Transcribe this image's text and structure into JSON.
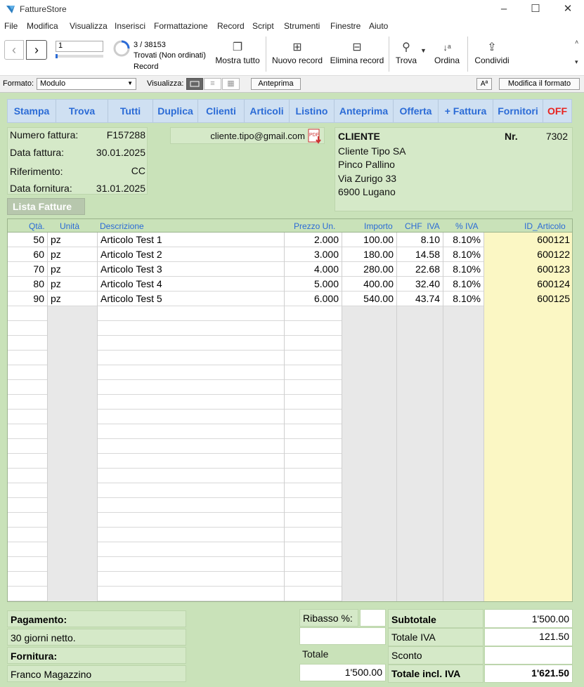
{
  "window": {
    "title": "FattureStore"
  },
  "menu": [
    "File",
    "Modifica",
    "Visualizza",
    "Inserisci",
    "Formattazione",
    "Record",
    "Script",
    "Strumenti",
    "Finestre",
    "Aiuto"
  ],
  "toolbar": {
    "record_field": "1",
    "record_count": "3 / 38153",
    "found_status": "Trovati (Non ordinati)",
    "record_label": "Record",
    "show_all": "Mostra tutto",
    "new_record": "Nuovo record",
    "delete_record": "Elimina record",
    "find": "Trova",
    "sort": "Ordina",
    "share": "Condividi"
  },
  "formatbar": {
    "format_label": "Formato:",
    "format_value": "Modulo",
    "view_label": "Visualizza:",
    "preview": "Anteprima",
    "aa": "Aª",
    "edit_layout": "Modifica il formato"
  },
  "nav": [
    "Stampa",
    "Trova",
    "Tutti",
    "Duplica",
    "Clienti",
    "Articoli",
    "Listino",
    "Anteprima",
    "Offerta",
    "+ Fattura",
    "Fornitori",
    "OFF"
  ],
  "colors": {
    "nav_text": "#2b6bd6",
    "off": "#e8231f",
    "bg": "#c9e2b9"
  },
  "invoice": {
    "number_label": "Numero fattura:",
    "number": "F157288",
    "date_label": "Data fattura:",
    "date": "30.01.2025",
    "ref_label": "Riferimento:",
    "ref": "CC",
    "supply_date_label": "Data fornitura:",
    "supply_date": "31.01.2025",
    "email": "cliente.tipo@gmail.com",
    "list_button": "Lista Fatture"
  },
  "client": {
    "heading": "CLIENTE",
    "nr_label": "Nr.",
    "nr": "7302",
    "lines": [
      "Cliente Tipo SA",
      "Pinco Pallino",
      "Via Zurigo 33",
      "6900 Lugano"
    ]
  },
  "table": {
    "headers": [
      "Qtà.",
      "Unità",
      "Descrizione",
      "Prezzo Un.",
      "Importo",
      "CHF  IVA",
      "% IVA",
      "ID_Articolo"
    ],
    "rows": [
      [
        "50",
        "pz",
        "Articolo Test 1",
        "2.000",
        "100.00",
        "8.10",
        "8.10%",
        "600121"
      ],
      [
        "60",
        "pz",
        "Articolo Test 2",
        "3.000",
        "180.00",
        "14.58",
        "8.10%",
        "600122"
      ],
      [
        "70",
        "pz",
        "Articolo Test 3",
        "4.000",
        "280.00",
        "22.68",
        "8.10%",
        "600123"
      ],
      [
        "80",
        "pz",
        "Articolo Test 4",
        "5.000",
        "400.00",
        "32.40",
        "8.10%",
        "600124"
      ],
      [
        "90",
        "pz",
        "Articolo Test 5",
        "6.000",
        "540.00",
        "43.74",
        "8.10%",
        "600125"
      ]
    ]
  },
  "footer": {
    "payment_label": "Pagamento:",
    "payment": "30 giorni netto.",
    "supply_label": "Fornitura:",
    "supply": "Franco Magazzino",
    "discount_label": "Ribasso %:",
    "discount": "",
    "total_label": "Totale",
    "total": "1'500.00",
    "subtotal_label": "Subtotale",
    "subtotal": "1'500.00",
    "vat_label": "Totale IVA",
    "vat": "121.50",
    "sconto_label": "Sconto",
    "sconto": "",
    "grand_label": "Totale incl. IVA",
    "grand": "1'621.50"
  }
}
